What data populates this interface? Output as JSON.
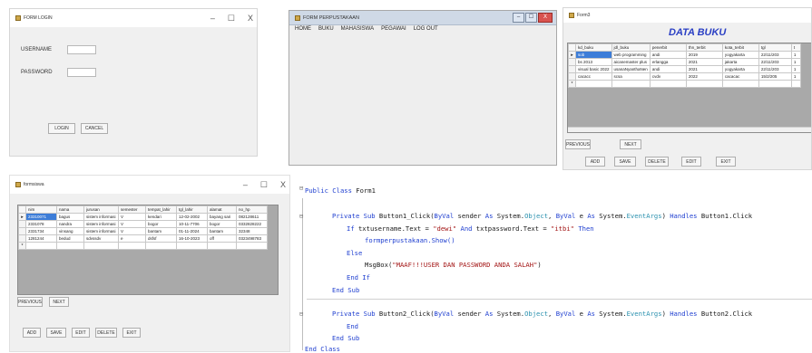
{
  "login": {
    "title": "FORM LOGIN",
    "controls": {
      "min": "–",
      "max": "☐",
      "close": "X"
    },
    "username_label": "USERNAME",
    "password_label": "PASSWORD",
    "login_btn": "LOGIN",
    "cancel_btn": "CANCEL"
  },
  "perpus": {
    "title": "FORM PERPUSTAKAAN",
    "controls": {
      "min": "–",
      "max": "☐",
      "close": "X"
    },
    "menu": [
      "HOME",
      "BUKU",
      "MAHASISWA",
      "PEGAWAI",
      "LOG OUT"
    ]
  },
  "buku": {
    "title": "Form3",
    "heading": "DATA BUKU",
    "columns": [
      "kd_buku",
      "jdl_buku",
      "penerbit",
      "thn_terbit",
      "kota_terbit",
      "tgl",
      "t"
    ],
    "rows": [
      [
        "sob",
        "web programming",
        "andi",
        "2019",
        "yogyakarta",
        "22/11/203",
        "1"
      ],
      [
        "bs 2013",
        "aicanemaster plus",
        "erlangga",
        "2021",
        "jakarta",
        "22/11/203",
        "1"
      ],
      [
        "visual basic 2022",
        "usanaNyanthaNen",
        "andi",
        "2021",
        "yogyakarta",
        "22/11/203",
        "1"
      ],
      [
        "cacacc",
        "scsa",
        "cvdv",
        "2022",
        "cacacac",
        "15/2/205",
        "1"
      ]
    ],
    "btn_previous": "PREVIOUS",
    "btn_next": "NEXT",
    "btn_add": "ADD",
    "btn_save": "SAVE",
    "btn_delete": "DELETE",
    "btn_edit": "EDIT",
    "btn_exit": "EXIT"
  },
  "mhs": {
    "title": "formsiswa",
    "controls": {
      "min": "–",
      "max": "☐",
      "close": "X"
    },
    "columns": [
      "nim",
      "nama",
      "jurusan",
      "semester",
      "tempat_lahir",
      "tgl_lahir",
      "alamat",
      "no_hp"
    ],
    "rows": [
      [
        "23310071",
        "bagus",
        "sistem informasi",
        "V",
        "kendari",
        "12-02-2002",
        "bayang sari",
        "082128611"
      ],
      [
        "2331078",
        "nandra",
        "sistem informasi",
        "V",
        "bogor",
        "10-11-7706",
        "bogor",
        "0332828222"
      ],
      [
        "2331734",
        "vinsang",
        "sistem informasi",
        "V",
        "bantam",
        "01-11-2024",
        "bantam",
        "32348"
      ],
      [
        "1281244",
        "bedud",
        "sdvssdv",
        "e",
        "dsfsf",
        "16-10-2023",
        "off",
        "0323498783"
      ]
    ],
    "btn_previous": "PREVIOUS",
    "btn_next": "NEXT",
    "btn_add": "ADD",
    "btn_save": "SAVE",
    "btn_edit": "EDIT",
    "btn_delete": "DELETE",
    "btn_exit": "EXIT"
  },
  "code": {
    "l1_kw": "Public Class",
    "l1_rest": " Form1",
    "l2_kw": "Private Sub",
    "l2_name": " Button1_Click(",
    "l2_kw2": "ByVal",
    "l2_a": " sender ",
    "l2_kw3": "As",
    "l2_b": " System.",
    "l2_ty": "Object",
    "l2_c": ", ",
    "l2_kw4": "ByVal",
    "l2_d": " e ",
    "l2_kw5": "As",
    "l2_e": " System.",
    "l2_ty2": "EventArgs",
    "l2_f": ") ",
    "l2_kw6": "Handles",
    "l2_g": " Button1.Click",
    "l3_kw": "If",
    "l3_a": " txtusername.Text = ",
    "l3_s1": "\"dewi\"",
    "l3_kw2": " And",
    "l3_b": " txtpassword.Text = ",
    "l3_s2": "\"itbi\"",
    "l3_kw3": " Then",
    "l4": "formperpustakaan.Show()",
    "l5_kw": "Else",
    "l6_a": "MsgBox(",
    "l6_s": "\"MAAF!!!USER DAN PASSWORD ANDA SALAH\"",
    "l6_b": ")",
    "l7_kw": "End If",
    "l8_kw": "End Sub",
    "l9_kw": "Private Sub",
    "l9_name": " Button2_Click(",
    "l9_kw2": "ByVal",
    "l9_a": " sender ",
    "l9_kw3": "As",
    "l9_b": " System.",
    "l9_ty": "Object",
    "l9_c": ", ",
    "l9_kw4": "ByVal",
    "l9_d": " e ",
    "l9_kw5": "As",
    "l9_e": " System.",
    "l9_ty2": "EventArgs",
    "l9_f": ") ",
    "l9_kw6": "Handles",
    "l9_g": " Button2.Click",
    "l10_kw": "End",
    "l11_kw": "End Sub",
    "l12_kw": "End Class"
  }
}
